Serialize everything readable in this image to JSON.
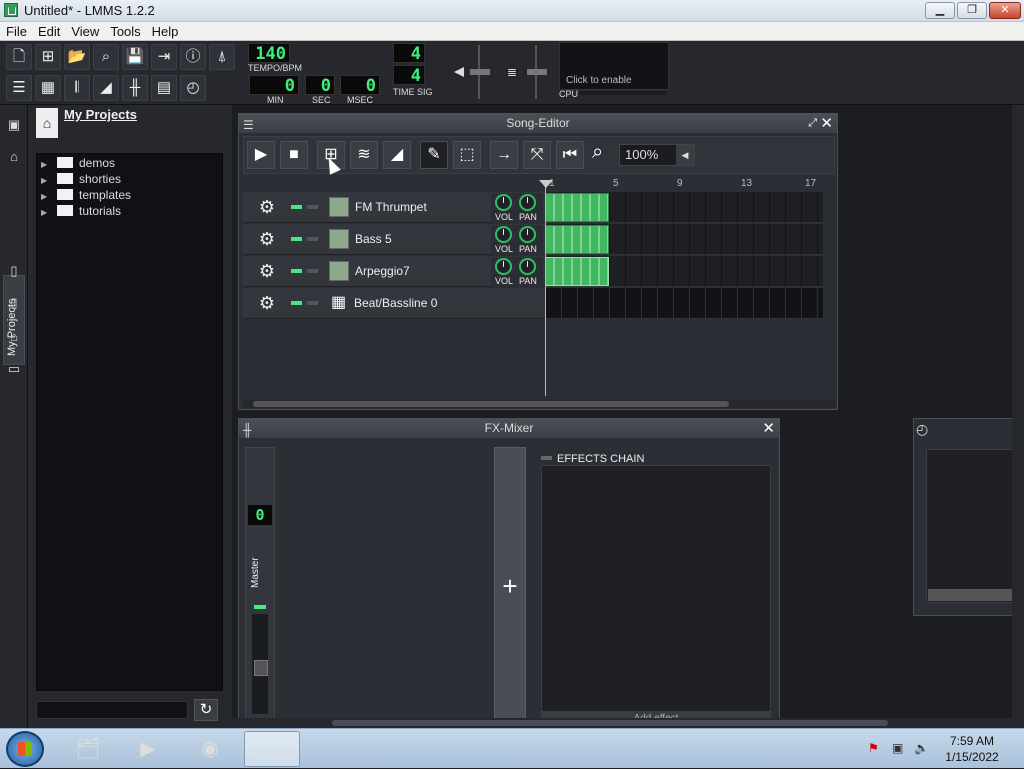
{
  "window": {
    "title": "Untitled* - LMMS 1.2.2"
  },
  "menu": [
    "File",
    "Edit",
    "View",
    "Tools",
    "Help"
  ],
  "toolbar": {
    "tempo": {
      "value": "140",
      "label": "TEMPO/BPM"
    },
    "time": {
      "min": "0",
      "sec": "0",
      "msec": "0",
      "min_label": "MIN",
      "sec_label": "SEC",
      "msec_label": "MSEC"
    },
    "timesig": {
      "num": "4",
      "den": "4",
      "label": "TIME SIG"
    },
    "cpu": {
      "hint": "Click to enable",
      "label": "CPU"
    }
  },
  "sidebar": {
    "tab_label": "My Projects"
  },
  "projects": {
    "title": "My Projects",
    "folders": [
      "demos",
      "shorties",
      "templates",
      "tutorials"
    ]
  },
  "song_editor": {
    "title": "Song-Editor",
    "zoom": "100%",
    "ruler": [
      "1",
      "5",
      "9",
      "13",
      "17"
    ],
    "tracks": [
      {
        "name": "FM Thrumpet",
        "vol": "VOL",
        "pan": "PAN"
      },
      {
        "name": "Bass 5",
        "vol": "VOL",
        "pan": "PAN"
      },
      {
        "name": "Arpeggio7",
        "vol": "VOL",
        "pan": "PAN"
      },
      {
        "name": "Beat/Bassline 0"
      }
    ]
  },
  "fx_mixer": {
    "title": "FX-Mixer",
    "master_label": "Master",
    "master_value": "0",
    "effects_chain": "EFFECTS CHAIN",
    "add_effect": "Add effect",
    "add_channel": "+"
  },
  "taskbar": {
    "time": "7:59 AM",
    "date": "1/15/2022"
  }
}
